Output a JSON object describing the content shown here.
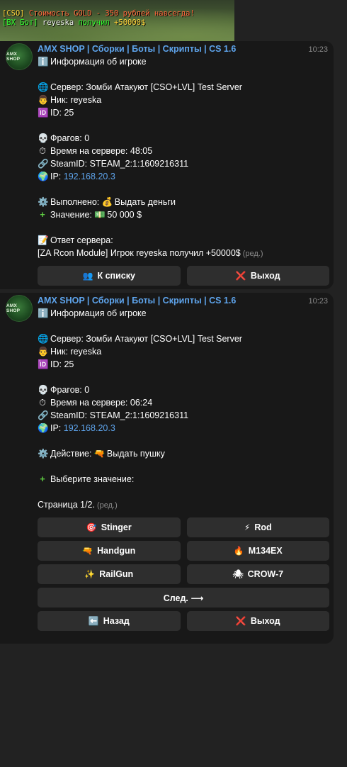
{
  "game_chat": {
    "line1": {
      "tag": "[CSO]",
      "text": " Стоимость GOLD - 350 рублей навсегда!"
    },
    "line2": {
      "tag": "[BX Бот]",
      "name": " reyeska",
      "action": " получил",
      "amount": " +50000$"
    }
  },
  "messages": [
    {
      "sender": "AMX SHOP | Сборки | Боты | Скрипты | CS 1.6",
      "avatar_text": "AMX SHOP",
      "time": "10:23",
      "title": "Информация об игроке",
      "server_label": "Сервер:",
      "server_value": "Зомби Атакуют [CSO+LVL] Test Server",
      "nick_label": "Ник:",
      "nick_value": "reyeska",
      "id_label": "ID:",
      "id_value": "25",
      "frags_label": "Фрагов:",
      "frags_value": "0",
      "time_label": "Время на сервере:",
      "time_value": "48:05",
      "steam_label": "SteamID:",
      "steam_value": "STEAM_2:1:1609216311",
      "ip_label": "IP:",
      "ip_value": "192.168.20.3",
      "done_label": "Выполнено:",
      "done_value": "Выдать деньги",
      "value_label": "Значение:",
      "value_value": "50 000 $",
      "response_label": "Ответ сервера:",
      "response_text": "[ZA Rcon Module] Игрок reyeska получил +50000$",
      "edited": "(ред.)",
      "buttons": {
        "list": "К списку",
        "exit": "Выход"
      }
    },
    {
      "sender": "AMX SHOP | Сборки | Боты | Скрипты | CS 1.6",
      "avatar_text": "AMX SHOP",
      "time": "10:23",
      "title": "Информация об игроке",
      "server_label": "Сервер:",
      "server_value": "Зомби Атакуют [CSO+LVL] Test Server",
      "nick_label": "Ник:",
      "nick_value": "reyeska",
      "id_label": "ID:",
      "id_value": "25",
      "frags_label": "Фрагов:",
      "frags_value": "0",
      "time_label": "Время на сервере:",
      "time_value": "06:24",
      "steam_label": "SteamID:",
      "steam_value": "STEAM_2:1:1609216311",
      "ip_label": "IP:",
      "ip_value": "192.168.20.3",
      "action_label": "Действие:",
      "action_value": "Выдать пушку",
      "choose_label": "Выберите значение:",
      "page_label": "Страница 1/2.",
      "edited": "(ред.)",
      "weapons": [
        "Stinger",
        "Rod",
        "Handgun",
        "M134EX",
        "RailGun",
        "CROW-7"
      ],
      "buttons": {
        "next": "След. ⟶",
        "back": "Назад",
        "exit": "Выход"
      }
    }
  ]
}
